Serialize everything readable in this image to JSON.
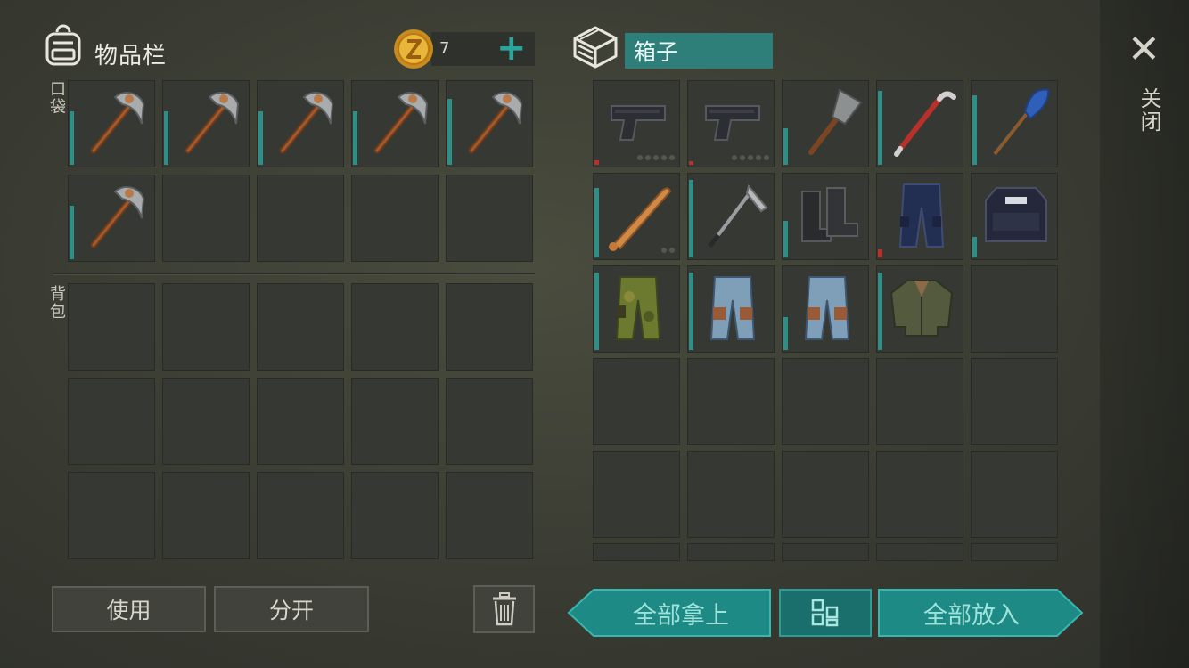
{
  "inventory": {
    "title": "物品栏",
    "pocket_label": "口袋",
    "backpack_label": "背包",
    "coins": "7",
    "add_symbol": "+"
  },
  "container": {
    "name": "箱子"
  },
  "close": {
    "label": "关闭",
    "symbol": "✕"
  },
  "buttons": {
    "use": "使用",
    "split": "分开",
    "take_all": "全部拿上",
    "put_all": "全部放入"
  },
  "pocket_items": [
    {
      "icon": "pickaxe-icon",
      "durability": 0.65
    },
    {
      "icon": "pickaxe-icon",
      "durability": 0.65
    },
    {
      "icon": "pickaxe-icon",
      "durability": 0.65
    },
    {
      "icon": "pickaxe-icon",
      "durability": 0.65
    },
    {
      "icon": "pickaxe-icon",
      "durability": 0.8
    },
    {
      "icon": "pickaxe-icon",
      "durability": 0.65
    }
  ],
  "container_items": [
    {
      "icon": "pistol-icon",
      "durability": 0.05,
      "low": true
    },
    {
      "icon": "pistol-icon",
      "durability": 0.03,
      "low": true
    },
    {
      "icon": "shovel-icon",
      "durability": 0.45
    },
    {
      "icon": "crowbar-icon",
      "durability": 0.9
    },
    {
      "icon": "paddle-icon",
      "durability": 0.85
    },
    {
      "icon": "baseball-bat-icon",
      "durability": 0.85
    },
    {
      "icon": "hoe-icon",
      "durability": 0.95
    },
    {
      "icon": "boots-icon",
      "durability": 0.45
    },
    {
      "icon": "police-pants-icon",
      "durability": 0.1,
      "low": true
    },
    {
      "icon": "police-vest-icon",
      "durability": 0.25
    },
    {
      "icon": "camo-pants-icon",
      "durability": 0.95
    },
    {
      "icon": "jeans-icon",
      "durability": 0.95
    },
    {
      "icon": "jeans-icon",
      "durability": 0.4
    },
    {
      "icon": "jacket-icon",
      "durability": 0.95
    }
  ],
  "colors": {
    "accent_teal": "#1d8a86",
    "durability_bar": "#2f8f86",
    "low_durability": "#b8312a",
    "slot_bg": "#363833"
  }
}
